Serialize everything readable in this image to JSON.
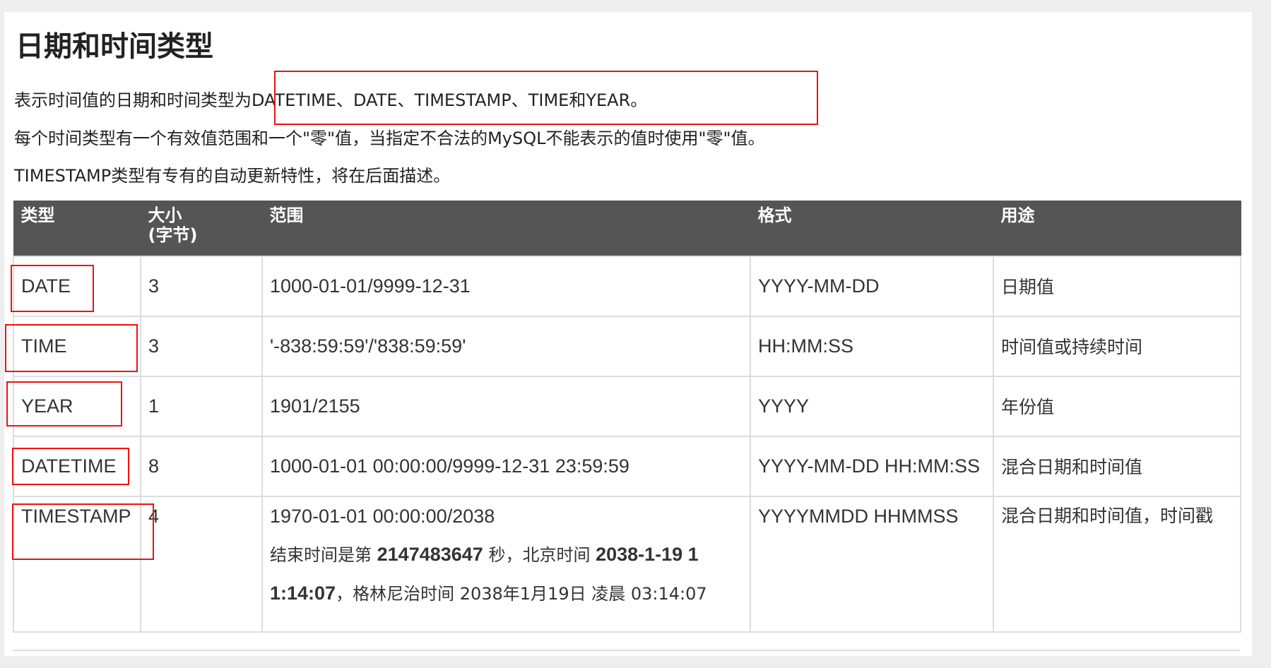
{
  "page": {
    "title": "日期和时间类型",
    "paragraphs": [
      "表示时间值的日期和时间类型为DATETIME、DATE、TIMESTAMP、TIME和YEAR。",
      "每个时间类型有一个有效值范围和一个\"零\"值，当指定不合法的MySQL不能表示的值时使用\"零\"值。",
      "TIMESTAMP类型有专有的自动更新特性，将在后面描述。"
    ]
  },
  "table": {
    "headers": {
      "type": "类型",
      "size_line1": "大小",
      "size_line2": "(字节)",
      "range": "范围",
      "format": "格式",
      "usage": "用途"
    },
    "rows": [
      {
        "type": "DATE",
        "size": "3",
        "range": "1000-01-01/9999-12-31",
        "format": "YYYY-MM-DD",
        "usage": "日期值"
      },
      {
        "type": "TIME",
        "size": "3",
        "range": "'-838:59:59'/'838:59:59'",
        "format": "HH:MM:SS",
        "usage": "时间值或持续时间"
      },
      {
        "type": "YEAR",
        "size": "1",
        "range": "1901/2155",
        "format": "YYYY",
        "usage": "年份值"
      },
      {
        "type": "DATETIME",
        "size": "8",
        "range": "1000-01-01 00:00:00/9999-12-31 23:59:59",
        "format": "YYYY-MM-DD HH:MM:SS",
        "usage": "混合日期和时间值"
      },
      {
        "type": "TIMESTAMP",
        "size": "4",
        "range": "1970-01-01 00:00:00/2038",
        "format": "YYYYMMDD HHMMSS",
        "usage": "混合日期和时间值，时间戳"
      }
    ],
    "timestamp_note": {
      "part1": "结束时间是第 ",
      "seconds": "2147483647",
      "part2": " 秒，北京时间 ",
      "beijing_a": "2038-1-19 1",
      "beijing_b": "1:14:07",
      "part3": "，格林尼治时间 2038年1月19日 凌晨 03:14:07"
    }
  },
  "colors": {
    "highlight": "#ee1111",
    "header_bg": "#555555",
    "border": "#dddddd"
  }
}
